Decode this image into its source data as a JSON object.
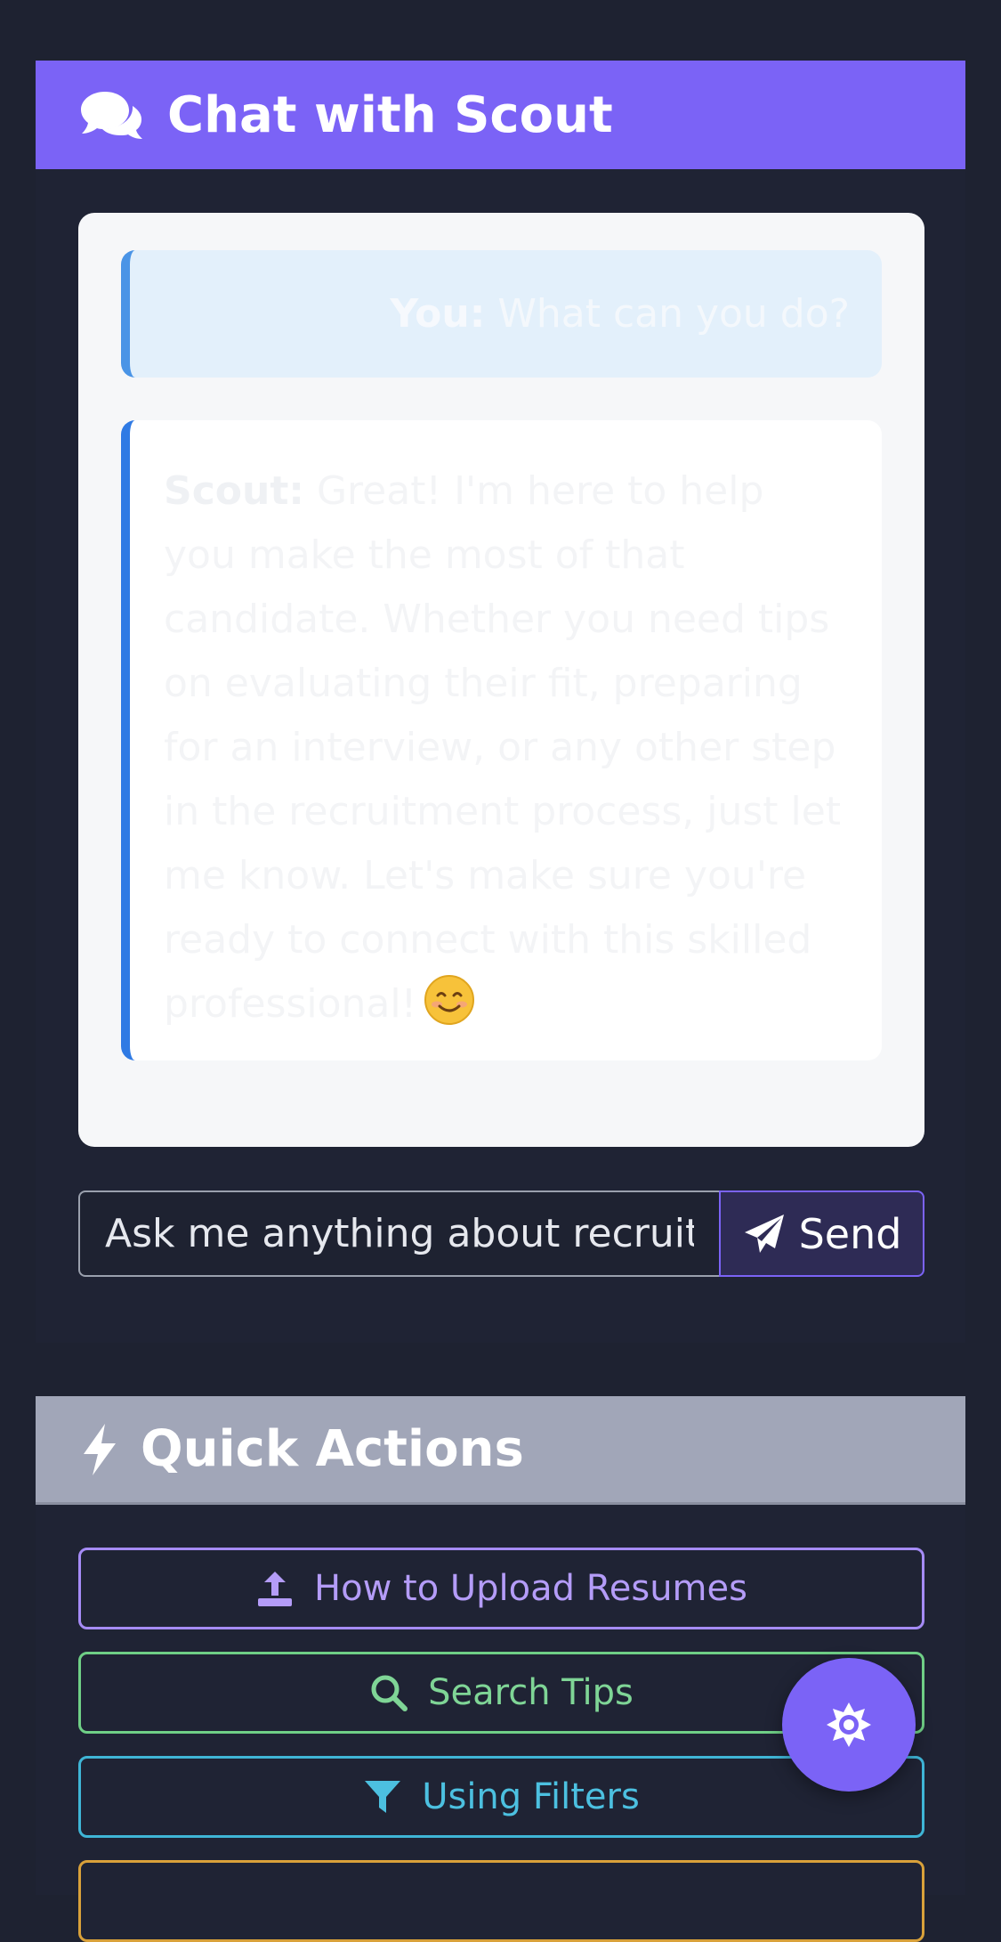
{
  "chat": {
    "title": "Chat with Scout",
    "header_icon": "comments-icon",
    "messages": [
      {
        "role": "user",
        "sender": "You:",
        "text": "What can you do?"
      },
      {
        "role": "assistant",
        "sender": "Scout:",
        "text": "Great! I'm here to help you make the most of that candidate. Whether you need tips on evaluating their fit, preparing for an interview, or any other step in the recruitment process, just let me know. Let's make sure you're ready to connect with this skilled professional!",
        "emoji": "smiling-face-emoji"
      }
    ],
    "input": {
      "placeholder": "Ask me anything about recruiting..."
    },
    "send": {
      "label": "Send",
      "icon": "paper-plane-icon"
    }
  },
  "quick_actions": {
    "title": "Quick Actions",
    "header_icon": "bolt-icon",
    "items": [
      {
        "label": "How to Upload Resumes",
        "icon": "upload-icon",
        "color": "#b49cf8"
      },
      {
        "label": "Search Tips",
        "icon": "search-icon",
        "color": "#7fd596"
      },
      {
        "label": "Using Filters",
        "icon": "filter-icon",
        "color": "#4cc0e0"
      }
    ]
  },
  "fab": {
    "icon": "gear-icon"
  },
  "colors": {
    "accent": "#7b63f6",
    "background": "#1e2231",
    "quick_actions_header": "#a1a6b8"
  }
}
